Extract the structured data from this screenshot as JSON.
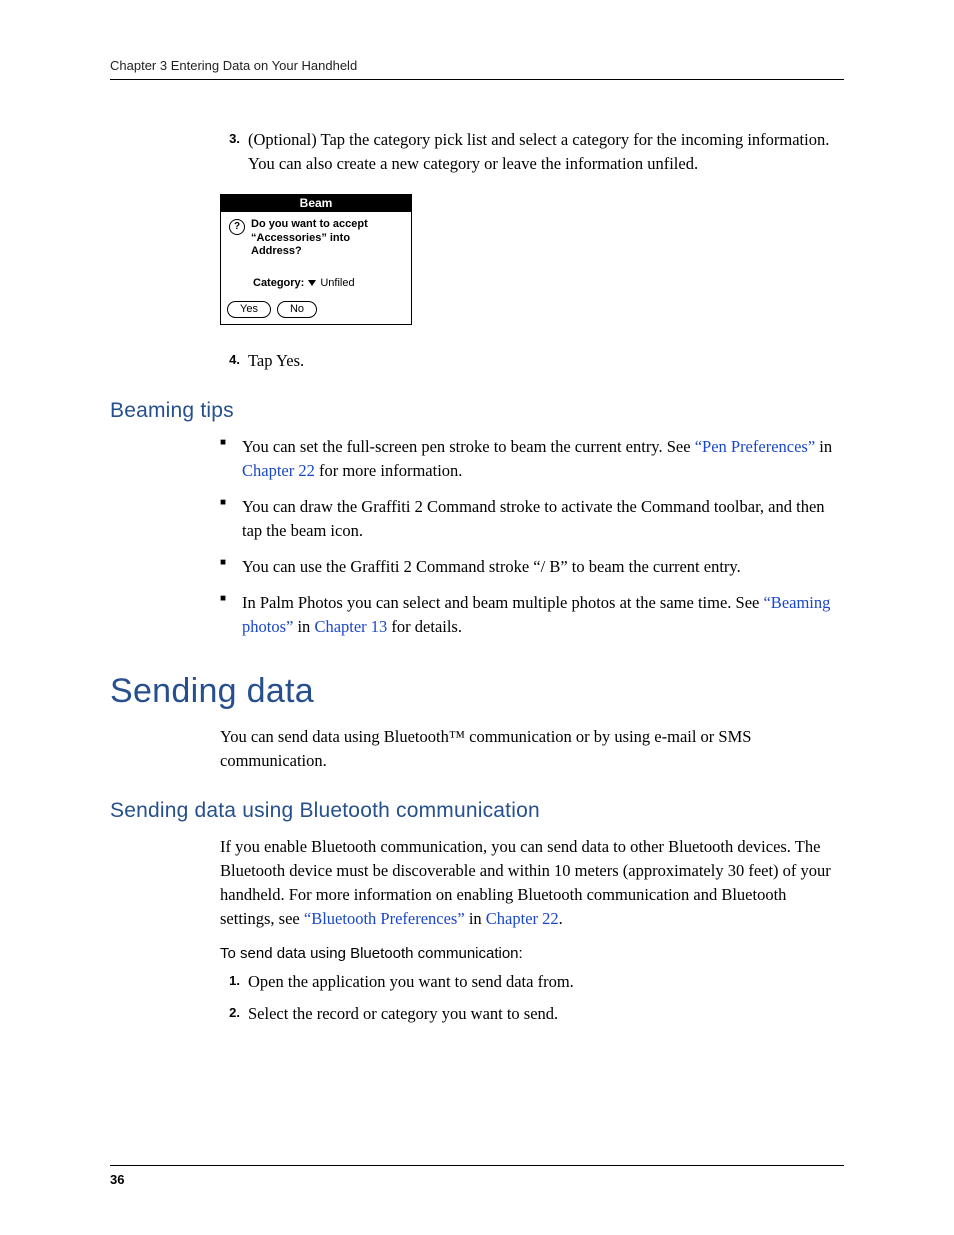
{
  "running_head": "Chapter 3   Entering Data on Your Handheld",
  "page_number": "36",
  "step3": {
    "num": "3.",
    "text": "(Optional) Tap the category pick list and select a category for the incoming information. You can also create a new category or leave the information unfiled."
  },
  "dialog": {
    "title": "Beam",
    "question": "Do you want to accept “Accessories” into Address?",
    "category_label": "Category:",
    "category_value": "Unfiled",
    "yes": "Yes",
    "no": "No"
  },
  "step4": {
    "num": "4.",
    "text": "Tap Yes."
  },
  "beaming_tips": {
    "heading": "Beaming tips",
    "items": [
      {
        "pre": "You can set the full-screen pen stroke to beam the current entry. See ",
        "link1": "“Pen Preferences”",
        "mid": " in ",
        "link2": "Chapter 22",
        "post": " for more information."
      },
      {
        "text": "You can draw the Graffiti 2 Command stroke to activate the Command toolbar, and then tap the beam icon."
      },
      {
        "text": "You can use the Graffiti 2 Command stroke “/ B” to beam the current entry."
      },
      {
        "pre": "In Palm Photos you can select and beam multiple photos at the same time. See ",
        "link1": "“Beaming photos”",
        "mid": " in ",
        "link2": "Chapter 13",
        "post": " for details."
      }
    ]
  },
  "sending_data": {
    "heading": "Sending data",
    "intro": "You can send data using Bluetooth™ communication or by using e-mail or SMS communication."
  },
  "bluetooth": {
    "heading": "Sending data using Bluetooth communication",
    "para_pre": "If you enable Bluetooth communication, you can send data to other Bluetooth devices. The Bluetooth device must be discoverable and within 10 meters (approximately 30 feet) of your handheld. For more information on enabling Bluetooth communication and Bluetooth settings, see ",
    "link1": "“Bluetooth Preferences”",
    "mid": " in ",
    "link2": "Chapter 22",
    "post": ".",
    "procedure_heading": "To send data using Bluetooth communication:",
    "steps": [
      {
        "num": "1.",
        "text": "Open the application you want to send data from."
      },
      {
        "num": "2.",
        "text": "Select the record or category you want to send."
      }
    ]
  }
}
